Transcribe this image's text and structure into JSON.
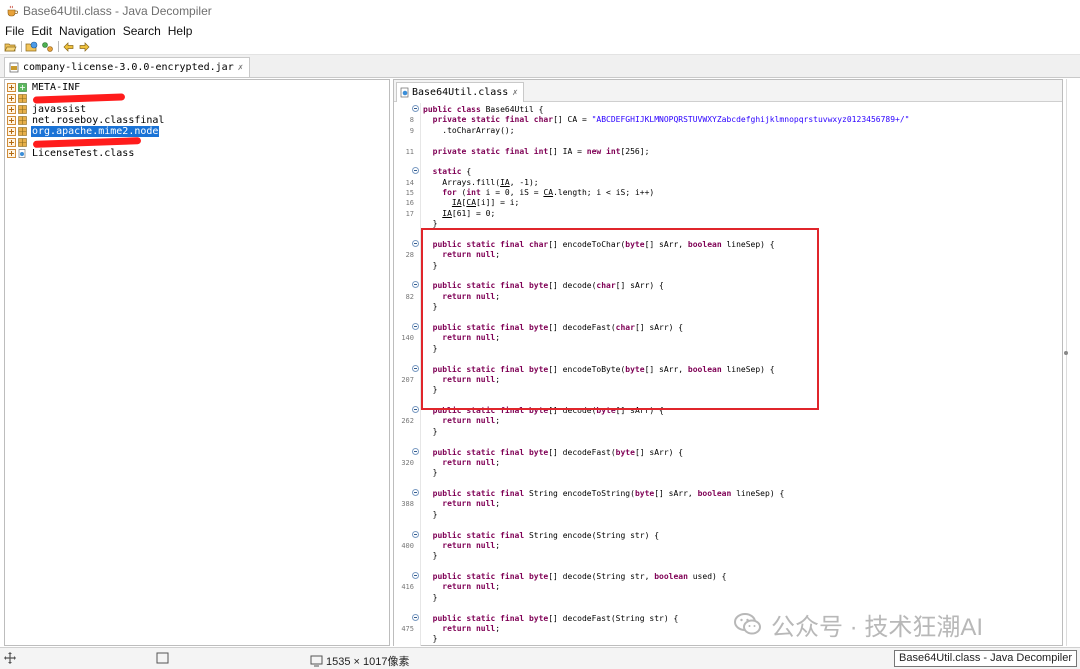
{
  "window": {
    "title": "Base64Util.class - Java Decompiler"
  },
  "menu": [
    "File",
    "Edit",
    "Navigation",
    "Search",
    "Help"
  ],
  "toolbar": {
    "buttons": [
      "open-file-icon",
      "open-type-icon",
      "back-arrow-icon",
      "forward-arrow-icon"
    ]
  },
  "jar_tab": {
    "label": "company-license-3.0.0-encrypted.jar",
    "close": "✗"
  },
  "tree": {
    "items": [
      {
        "label": "META-INF",
        "selected": false,
        "redacted": false
      },
      {
        "label": "",
        "selected": false,
        "redacted": true
      },
      {
        "label": "javassist",
        "selected": false,
        "redacted": false
      },
      {
        "label": "net.roseboy.classfinal",
        "selected": false,
        "redacted": false
      },
      {
        "label": "org.apache.mime2.node",
        "selected": true,
        "redacted": false
      },
      {
        "label": "",
        "selected": false,
        "redacted": true
      },
      {
        "label": "LicenseTest.class",
        "selected": false,
        "redacted": false
      }
    ]
  },
  "editor": {
    "tab_label": "Base64Util.class",
    "tab_close": "✗",
    "lines": [
      {
        "n": "",
        "fold": true,
        "html": "<span class=\"kw\">public class</span> Base64Util {"
      },
      {
        "n": "8",
        "fold": false,
        "html": "  <span class=\"kw\">private static final char</span>[] CA = <span class=\"str\">\"ABCDEFGHIJKLMNOPQRSTUVWXYZabcdefghijklmnopqrstuvwxyz0123456789+/\"</span>"
      },
      {
        "n": "9",
        "fold": false,
        "html": "    .toCharArray();"
      },
      {
        "n": "",
        "fold": false,
        "html": ""
      },
      {
        "n": "11",
        "fold": false,
        "html": "  <span class=\"kw\">private static final int</span>[] IA = <span class=\"kw\">new int</span>[256];"
      },
      {
        "n": "",
        "fold": false,
        "html": ""
      },
      {
        "n": "",
        "fold": true,
        "html": "  <span class=\"kw\">static</span> {"
      },
      {
        "n": "14",
        "fold": false,
        "html": "    Arrays.fill(<span class=\"ul\">IA</span>, -1);"
      },
      {
        "n": "15",
        "fold": false,
        "html": "    <span class=\"kw\">for</span> (<span class=\"kw\">int</span> i = 0, iS = <span class=\"ul\">CA</span>.length; i &lt; iS; i++)"
      },
      {
        "n": "16",
        "fold": false,
        "html": "      <span class=\"ul\">IA</span>[<span class=\"ul\">CA</span>[i]] = i;"
      },
      {
        "n": "17",
        "fold": false,
        "html": "    <span class=\"ul\">IA</span>[61] = 0;"
      },
      {
        "n": "",
        "fold": false,
        "html": "  }"
      },
      {
        "n": "",
        "fold": false,
        "html": ""
      },
      {
        "n": "",
        "fold": true,
        "html": "  <span class=\"kw\">public static final char</span>[] encodeToChar(<span class=\"kw\">byte</span>[] sArr, <span class=\"kw\">boolean</span> lineSep) {"
      },
      {
        "n": "28",
        "fold": false,
        "html": "    <span class=\"kw\">return null</span>;"
      },
      {
        "n": "",
        "fold": false,
        "html": "  }"
      },
      {
        "n": "",
        "fold": false,
        "html": ""
      },
      {
        "n": "",
        "fold": true,
        "html": "  <span class=\"kw\">public static final byte</span>[] decode(<span class=\"kw\">char</span>[] sArr) {"
      },
      {
        "n": "82",
        "fold": false,
        "html": "    <span class=\"kw\">return null</span>;"
      },
      {
        "n": "",
        "fold": false,
        "html": "  }"
      },
      {
        "n": "",
        "fold": false,
        "html": ""
      },
      {
        "n": "",
        "fold": true,
        "html": "  <span class=\"kw\">public static final byte</span>[] decodeFast(<span class=\"kw\">char</span>[] sArr) {"
      },
      {
        "n": "140",
        "fold": false,
        "html": "    <span class=\"kw\">return null</span>;"
      },
      {
        "n": "",
        "fold": false,
        "html": "  }"
      },
      {
        "n": "",
        "fold": false,
        "html": ""
      },
      {
        "n": "",
        "fold": true,
        "html": "  <span class=\"kw\">public static final byte</span>[] encodeToByte(<span class=\"kw\">byte</span>[] sArr, <span class=\"kw\">boolean</span> lineSep) {"
      },
      {
        "n": "207",
        "fold": false,
        "html": "    <span class=\"kw\">return null</span>;"
      },
      {
        "n": "",
        "fold": false,
        "html": "  }"
      },
      {
        "n": "",
        "fold": false,
        "html": ""
      },
      {
        "n": "",
        "fold": true,
        "html": "  <span class=\"kw\">public static final byte</span>[] decode(<span class=\"kw\">byte</span>[] sArr) {"
      },
      {
        "n": "262",
        "fold": false,
        "html": "    <span class=\"kw\">return null</span>;"
      },
      {
        "n": "",
        "fold": false,
        "html": "  }"
      },
      {
        "n": "",
        "fold": false,
        "html": ""
      },
      {
        "n": "",
        "fold": true,
        "html": "  <span class=\"kw\">public static final byte</span>[] decodeFast(<span class=\"kw\">byte</span>[] sArr) {"
      },
      {
        "n": "320",
        "fold": false,
        "html": "    <span class=\"kw\">return null</span>;"
      },
      {
        "n": "",
        "fold": false,
        "html": "  }"
      },
      {
        "n": "",
        "fold": false,
        "html": ""
      },
      {
        "n": "",
        "fold": true,
        "html": "  <span class=\"kw\">public static final</span> String encodeToString(<span class=\"kw\">byte</span>[] sArr, <span class=\"kw\">boolean</span> lineSep) {"
      },
      {
        "n": "388",
        "fold": false,
        "html": "    <span class=\"kw\">return null</span>;"
      },
      {
        "n": "",
        "fold": false,
        "html": "  }"
      },
      {
        "n": "",
        "fold": false,
        "html": ""
      },
      {
        "n": "",
        "fold": true,
        "html": "  <span class=\"kw\">public static final</span> String encode(String str) {"
      },
      {
        "n": "400",
        "fold": false,
        "html": "    <span class=\"kw\">return null</span>;"
      },
      {
        "n": "",
        "fold": false,
        "html": "  }"
      },
      {
        "n": "",
        "fold": false,
        "html": ""
      },
      {
        "n": "",
        "fold": true,
        "html": "  <span class=\"kw\">public static final byte</span>[] decode(String str, <span class=\"kw\">boolean</span> used) {"
      },
      {
        "n": "416",
        "fold": false,
        "html": "    <span class=\"kw\">return null</span>;"
      },
      {
        "n": "",
        "fold": false,
        "html": "  }"
      },
      {
        "n": "",
        "fold": false,
        "html": ""
      },
      {
        "n": "",
        "fold": true,
        "html": "  <span class=\"kw\">public static final byte</span>[] decodeFast(String str) {"
      },
      {
        "n": "475",
        "fold": false,
        "html": "    <span class=\"kw\">return null</span>;"
      },
      {
        "n": "",
        "fold": false,
        "html": "  }"
      }
    ]
  },
  "highlight": {
    "color": "#e0252b"
  },
  "statusbar": {
    "dimensions": "1535 × 1017像素"
  },
  "tooltip": {
    "text": "Base64Util.class - Java Decompiler"
  },
  "watermark": {
    "text": "公众号 · 技术狂潮AI"
  },
  "colors": {
    "keyword": "#7f0055",
    "string": "#2a00ff",
    "selection": "#1a73d6",
    "redaction": "#ff1c1c"
  }
}
